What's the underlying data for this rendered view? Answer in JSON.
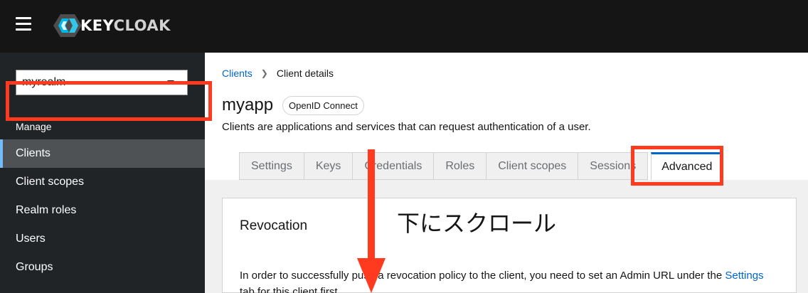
{
  "header": {
    "logo_key": "KEY",
    "logo_rest": "CLOAK",
    "icons": [
      "menu-icon",
      "keycloak-logo-icon"
    ]
  },
  "sidebar": {
    "realm": "myrealm",
    "section": "Manage",
    "items": [
      {
        "label": "Clients",
        "active": true
      },
      {
        "label": "Client scopes"
      },
      {
        "label": "Realm roles"
      },
      {
        "label": "Users"
      },
      {
        "label": "Groups"
      }
    ]
  },
  "breadcrumb": {
    "parent": "Clients",
    "current": "Client details"
  },
  "client": {
    "name": "myapp",
    "protocol": "OpenID Connect",
    "description": "Clients are applications and services that can request authentication of a user."
  },
  "tabs": [
    {
      "label": "Settings"
    },
    {
      "label": "Keys"
    },
    {
      "label": "Credentials"
    },
    {
      "label": "Roles"
    },
    {
      "label": "Client scopes"
    },
    {
      "label": "Sessions"
    },
    {
      "label": "Advanced",
      "active": true
    }
  ],
  "revocation": {
    "title": "Revocation",
    "text_before": "In order to successfully push a revocation policy to the client, you need to set an Admin URL under the ",
    "text_link": "Settings",
    "text_after": " tab for this client first."
  },
  "annotation": {
    "text": "下にスクロール"
  },
  "colors": {
    "header_bg": "#151515",
    "sidebar_bg": "#212427",
    "highlight": "#ff3a1f",
    "link": "#0066cc"
  }
}
